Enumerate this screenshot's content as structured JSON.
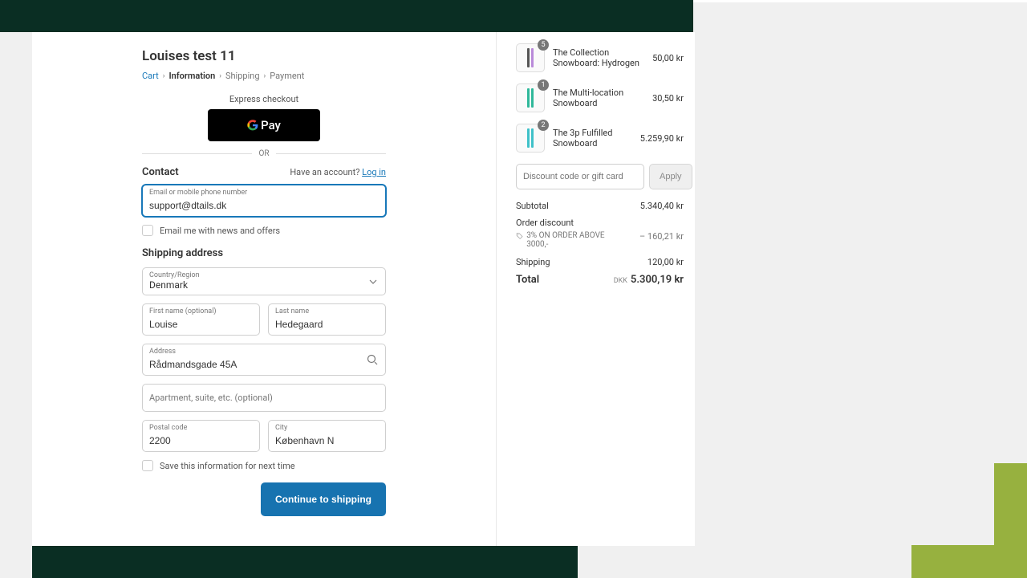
{
  "store": {
    "title": "Louises test 11"
  },
  "breadcrumb": {
    "cart": "Cart",
    "information": "Information",
    "shipping": "Shipping",
    "payment": "Payment"
  },
  "express": {
    "label": "Express checkout",
    "gpay": "Pay",
    "or": "OR"
  },
  "contact": {
    "heading": "Contact",
    "have_account": "Have an account?",
    "login": "Log in",
    "email_label": "Email or mobile phone number",
    "email_value": "support@dtails.dk",
    "news_opt": "Email me with news and offers"
  },
  "shipping": {
    "heading": "Shipping address",
    "country_label": "Country/Region",
    "country_value": "Denmark",
    "first_label": "First name (optional)",
    "first_value": "Louise",
    "last_label": "Last name",
    "last_value": "Hedegaard",
    "address_label": "Address",
    "address_value": "Rådmandsgade 45A",
    "apt_placeholder": "Apartment, suite, etc. (optional)",
    "postal_label": "Postal code",
    "postal_value": "2200",
    "city_label": "City",
    "city_value": "København N",
    "save_opt": "Save this information for next time",
    "cta": "Continue to shipping"
  },
  "cart": {
    "items": [
      {
        "qty": "5",
        "name": "The Collection Snowboard: Hydrogen",
        "price": "50,00 kr",
        "colors": [
          "#555",
          "#b98ad9"
        ]
      },
      {
        "qty": "1",
        "name": "The Multi-location Snowboard",
        "price": "30,50 kr",
        "colors": [
          "#2fb89a",
          "#2fb89a"
        ]
      },
      {
        "qty": "2",
        "name": "The 3p Fulfilled Snowboard",
        "price": "5.259,90 kr",
        "colors": [
          "#3fc1c9",
          "#3fc1c9"
        ]
      }
    ],
    "discount_placeholder": "Discount code or gift card",
    "apply": "Apply",
    "subtotal_label": "Subtotal",
    "subtotal": "5.340,40 kr",
    "order_discount_label": "Order discount",
    "discount_name": "3% ON ORDER ABOVE 3000,-",
    "discount_value": "– 160,21 kr",
    "shipping_label": "Shipping",
    "shipping_value": "120,00 kr",
    "total_label": "Total",
    "currency": "DKK",
    "total_value": "5.300,19 kr"
  }
}
